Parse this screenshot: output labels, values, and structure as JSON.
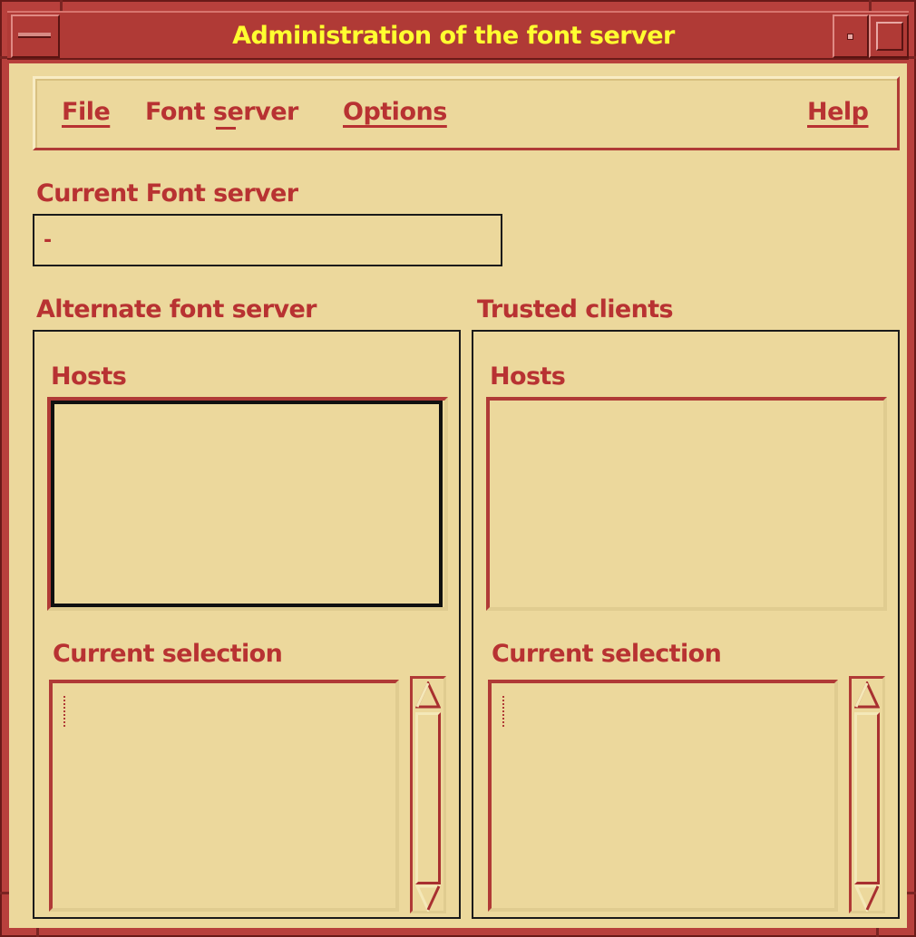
{
  "window": {
    "title": "Administration of the font server"
  },
  "menubar": {
    "file": "File",
    "font_server": "Font server",
    "options": "Options",
    "help": "Help"
  },
  "current_server": {
    "label": "Current Font server",
    "value": "-"
  },
  "alternate": {
    "group_label": "Alternate font server",
    "hosts_label": "Hosts",
    "selection_label": "Current selection"
  },
  "trusted": {
    "group_label": "Trusted clients",
    "hosts_label": "Hosts",
    "selection_label": "Current selection"
  },
  "colors": {
    "frame": "#b8403c",
    "client_bg": "#ecd89c",
    "label_text": "#b83232",
    "title_text": "#ffff30"
  }
}
